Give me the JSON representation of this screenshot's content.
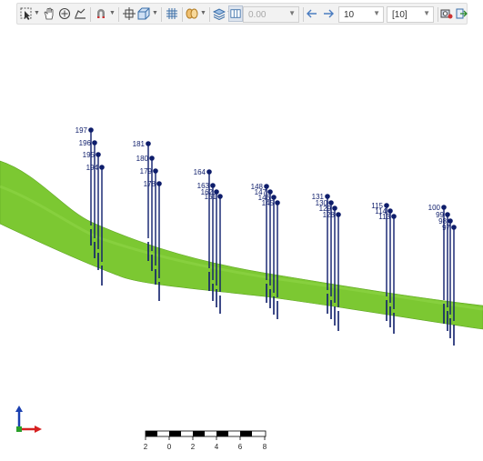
{
  "toolbar": {
    "offset_value": "0.00",
    "step_value": "10",
    "range_value": "[10]"
  },
  "scale_bar": {
    "ticks": [
      "2",
      "0",
      "2",
      "4",
      "6",
      "8"
    ]
  },
  "wells": [
    {
      "group": 1,
      "markers": [
        "197",
        "196",
        "195",
        "194"
      ]
    },
    {
      "group": 2,
      "markers": [
        "181",
        "180",
        "179",
        "178"
      ]
    },
    {
      "group": 3,
      "markers": [
        "164",
        "163",
        "162",
        "161"
      ]
    },
    {
      "group": 4,
      "markers": [
        "148",
        "147",
        "146",
        "145"
      ]
    },
    {
      "group": 5,
      "markers": [
        "131",
        "130",
        "129",
        "128"
      ]
    },
    {
      "group": 6,
      "markers": [
        "115",
        "114",
        "113"
      ]
    },
    {
      "group": 7,
      "markers": [
        "100",
        "99",
        "98",
        "97"
      ]
    }
  ],
  "colors": {
    "surface": "#7cc832",
    "surface_edge": "#5fa524",
    "wells": "#0e1d6b",
    "axis_x": "#d62020",
    "axis_y": "#1a3fb0"
  }
}
